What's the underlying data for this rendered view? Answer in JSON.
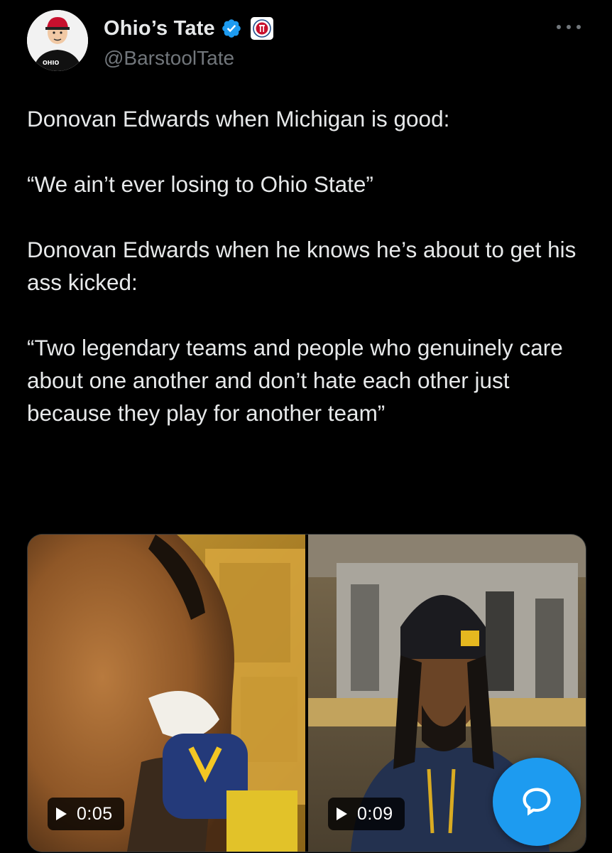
{
  "author": {
    "display_name": "Ohio’s Tate",
    "handle": "@BarstoolTate",
    "verified": true,
    "affiliate_badge": "barstool-logo",
    "avatar_text": "OHIO AGAINST"
  },
  "tweet": {
    "paragraphs": [
      "Donovan Edwards when Michigan is good:",
      "“We ain’t ever losing to Ohio State”",
      "Donovan Edwards when he knows he’s about to get his ass kicked:",
      "“Two legendary teams and people who genuinely care about one another and don’t hate each other just because they play for another team”"
    ]
  },
  "media": [
    {
      "type": "video",
      "duration": "0:05"
    },
    {
      "type": "video",
      "duration": "0:09"
    }
  ],
  "icons": {
    "more": "more-horizontal-icon",
    "verified": "verified-badge-icon",
    "play": "play-icon",
    "reply": "reply-bubble-icon"
  },
  "colors": {
    "background": "#000000",
    "text_primary": "#e7e9ea",
    "text_secondary": "#71767b",
    "accent": "#1d9bf0"
  }
}
